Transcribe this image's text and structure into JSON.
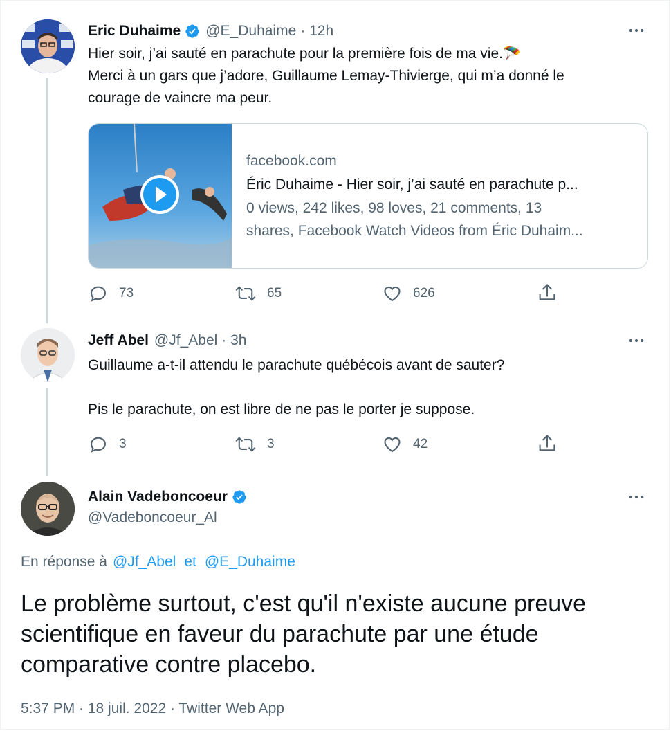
{
  "tweet1": {
    "name": "Eric Duhaime",
    "handle": "@E_Duhaime",
    "time": "· 12h",
    "line1": "Hier soir, j’ai sauté en parachute pour la première fois de ma vie.🪂",
    "line2": "Merci à un gars que j’adore, Guillaume Lemay-Thivierge, qui m’a donné le",
    "line3": "courage de vaincre ma peur.",
    "card": {
      "domain": "facebook.com",
      "title": "Éric Duhaime - Hier soir, j’ai sauté en parachute p...",
      "desc1": "0 views, 242 likes, 98 loves, 21 comments, 13",
      "desc2": "shares, Facebook Watch Videos from Éric Duhaim..."
    },
    "replies": "73",
    "retweets": "65",
    "likes": "626"
  },
  "tweet2": {
    "name": "Jeff Abel",
    "handle": "@Jf_Abel",
    "time": "· 3h",
    "line1": "Guillaume a-t-il attendu le parachute québécois avant de sauter?",
    "line2": "Pis le parachute, on est libre de ne pas le porter je suppose.",
    "replies": "3",
    "retweets": "3",
    "likes": "42"
  },
  "main": {
    "name": "Alain Vadeboncoeur",
    "handle": "@Vadeboncoeur_Al",
    "reply_prefix": "En réponse à",
    "reply_to1": "@Jf_Abel",
    "reply_and": "et",
    "reply_to2": "@E_Duhaime",
    "line1": "Le problème surtout, c'est qu'il n'existe aucune preuve",
    "line2": "scientifique en faveur du parachute par une étude",
    "line3": "comparative contre placebo.",
    "timestamp": "5:37 PM · 18 juil. 2022 · Twitter Web App"
  },
  "avatar1_text": "ERIC DUHAIME",
  "icons": [
    "more-icon",
    "verified-icon",
    "reply-icon",
    "retweet-icon",
    "like-icon",
    "share-icon",
    "play-icon"
  ],
  "colors": {
    "accent": "#1d9bf0",
    "text": "#0f1419",
    "muted": "#536471",
    "border": "#cfd9de"
  }
}
